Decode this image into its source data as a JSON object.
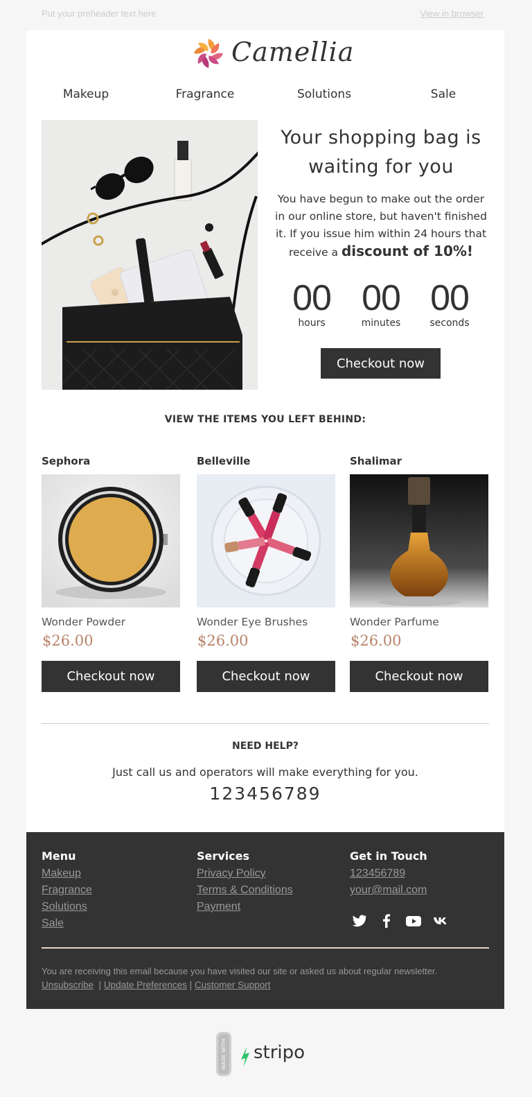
{
  "preheader": {
    "text": "Put your preheader text here",
    "view_link": "View in browser"
  },
  "brand": {
    "name": "Camellia",
    "logo_icon": "camellia-flower-logo"
  },
  "nav": [
    {
      "label": "Makeup"
    },
    {
      "label": "Fragrance"
    },
    {
      "label": "Solutions"
    },
    {
      "label": "Sale"
    }
  ],
  "hero": {
    "image": "handbag-flatlay-photo",
    "title_line1": "Your shopping bag is",
    "title_line2": "waiting for you",
    "body": "You have begun to make out the order in our online store, but haven't finished it. If you issue him within 24 hours that receive a ",
    "highlight": "discount of 10%!",
    "countdown": [
      {
        "value": "00",
        "label": "hours"
      },
      {
        "value": "00",
        "label": "minutes"
      },
      {
        "value": "00",
        "label": "seconds"
      }
    ],
    "button": "Checkout now"
  },
  "items_heading": "VIEW THE ITEMS YOU LEFT BEHIND:",
  "products": [
    {
      "brand": "Sephora",
      "name": "Wonder Powder",
      "price": "$26.00",
      "button": "Checkout now",
      "image": "powder-compact-photo"
    },
    {
      "brand": "Belleville",
      "name": "Wonder Eye Brushes",
      "price": "$26.00",
      "button": "Checkout now",
      "image": "lipstick-brushes-photo"
    },
    {
      "brand": "Shalimar",
      "name": "Wonder Parfume",
      "price": "$26.00",
      "button": "Checkout now",
      "image": "perfume-bottle-photo"
    }
  ],
  "help": {
    "heading": "NEED HELP?",
    "text": "Just call us and operators will make everything for you.",
    "phone": "123456789"
  },
  "footer": {
    "menu": {
      "heading": "Menu",
      "links": [
        "Makeup",
        "Fragrance",
        "Solutions",
        "Sale"
      ]
    },
    "services": {
      "heading": "Services",
      "links": [
        "Privacy Policy",
        "Terms & Conditions",
        "Payment"
      ]
    },
    "contact": {
      "heading": "Get in Touch",
      "phone": "123456789",
      "email": "your@mail.com"
    },
    "social_icons": [
      "twitter-icon",
      "facebook-icon",
      "youtube-icon",
      "vk-icon"
    ],
    "note": "You are receiving this email because you have visited our site or asked us about regular newsletter.",
    "unsubscribe": "Unsubscribe",
    "update_prefs": "Update Preferences",
    "support": "Customer Support"
  },
  "made_with": {
    "badge": "MADE WITH",
    "name": "stripo"
  },
  "colors": {
    "page_bg": "#f6f6f6",
    "button_bg": "#333333",
    "price": "#b8836a",
    "footer_bg": "#333333",
    "footer_link": "#999999"
  }
}
